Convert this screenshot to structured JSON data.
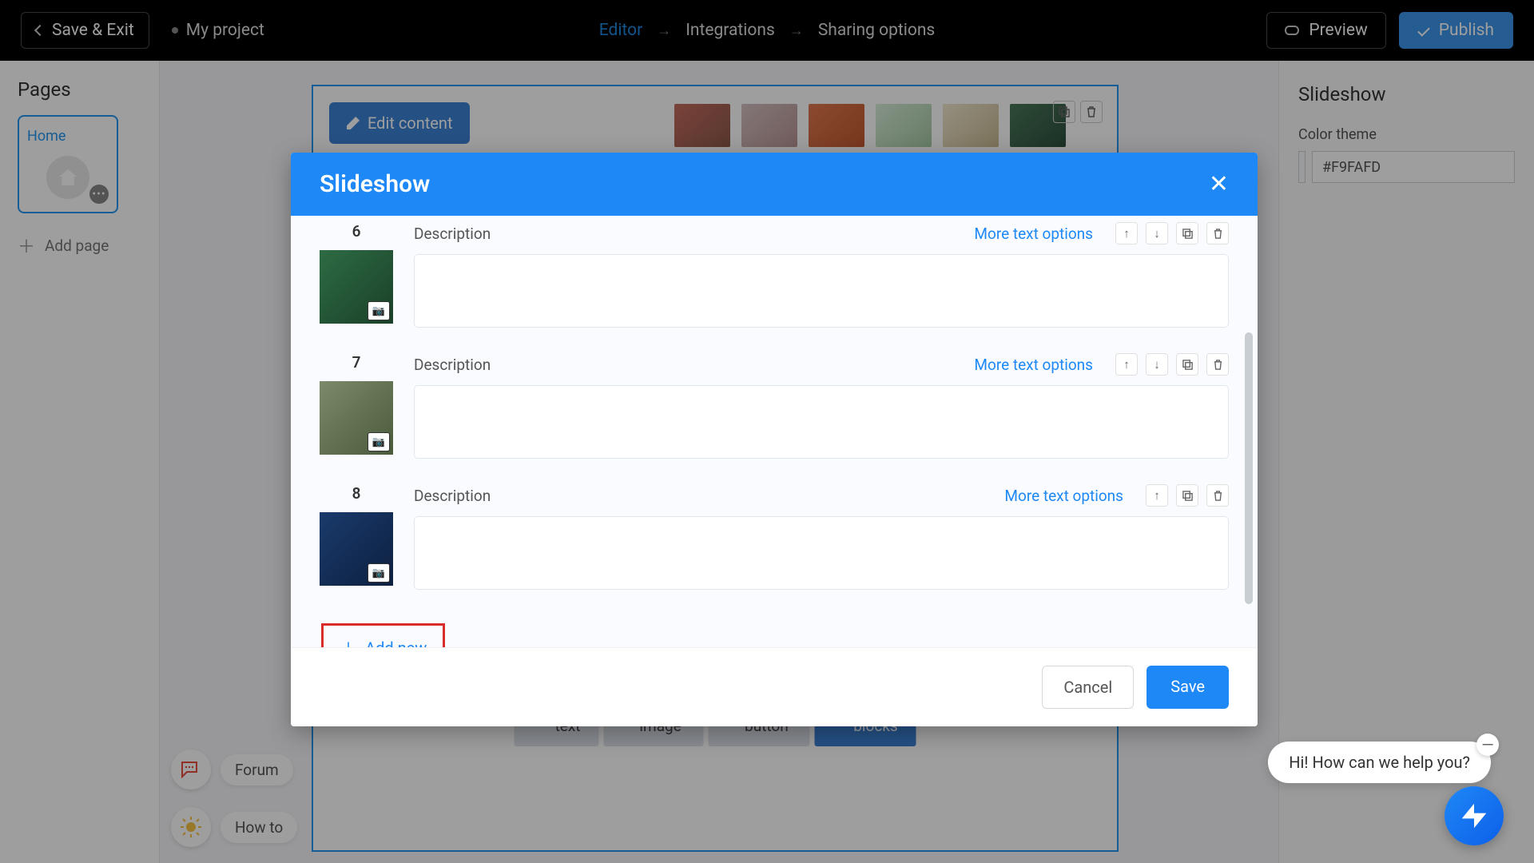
{
  "topbar": {
    "save_exit": "Save & Exit",
    "project_name": "My project",
    "nav": {
      "editor": "Editor",
      "integrations": "Integrations",
      "sharing": "Sharing options"
    },
    "preview": "Preview",
    "publish": "Publish"
  },
  "left": {
    "title": "Pages",
    "page1": "Home",
    "add_page": "Add page"
  },
  "canvas": {
    "edit_content": "Edit content",
    "toolbar": {
      "add_text": "Add text",
      "add_image": "Add image",
      "add_button": "Add button",
      "all_blocks": "All blocks"
    }
  },
  "right": {
    "title": "Slideshow",
    "color_theme_label": "Color theme",
    "color_value": "#F9FAFD"
  },
  "modal": {
    "title": "Slideshow",
    "description_label": "Description",
    "more_text": "More text options",
    "slides": {
      "0": {
        "num": "6"
      },
      "1": {
        "num": "7"
      },
      "2": {
        "num": "8"
      }
    },
    "add_new": "Add new",
    "cancel": "Cancel",
    "save": "Save"
  },
  "help": {
    "forum": "Forum",
    "howto": "How to",
    "chat": "Hi! How can we help you?"
  }
}
